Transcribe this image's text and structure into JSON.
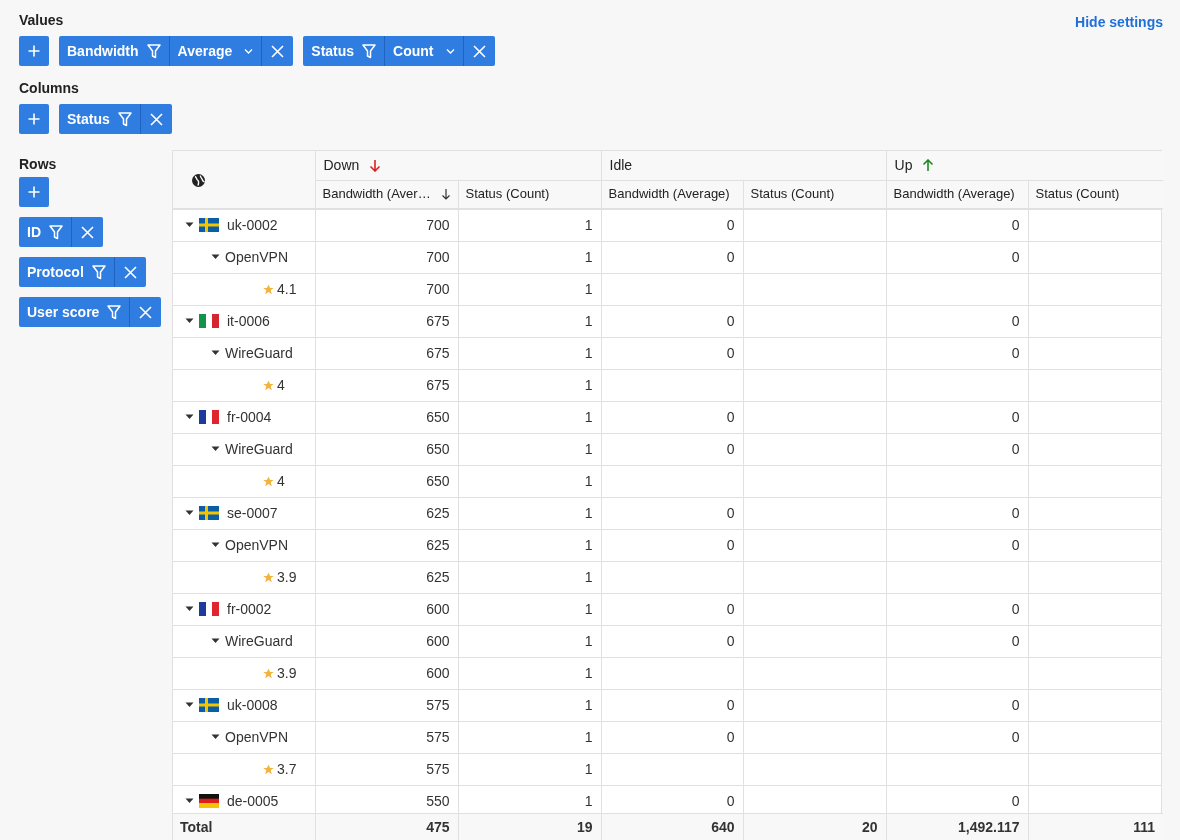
{
  "settings_link": "Hide settings",
  "values": {
    "label": "Values",
    "chips": [
      {
        "field": "Bandwidth",
        "aggregation": "Average"
      },
      {
        "field": "Status",
        "aggregation": "Count"
      }
    ]
  },
  "columns": {
    "label": "Columns",
    "chips": [
      {
        "field": "Status"
      }
    ]
  },
  "rows": {
    "label": "Rows",
    "chips": [
      {
        "field": "ID"
      },
      {
        "field": "Protocol"
      },
      {
        "field": "User score"
      }
    ]
  },
  "table": {
    "column_groups": [
      {
        "label": "Down",
        "kind": "down"
      },
      {
        "label": "Idle",
        "kind": "plain"
      },
      {
        "label": "Up",
        "kind": "up"
      }
    ],
    "columns": [
      {
        "label": "Bandwidth (Aver…",
        "sorted": true
      },
      {
        "label": "Status (Count)",
        "sorted": false
      },
      {
        "label": "Bandwidth (Average)",
        "sorted": false
      },
      {
        "label": "Status (Count)",
        "sorted": false
      },
      {
        "label": "Bandwidth (Average)",
        "sorted": false
      },
      {
        "label": "Status (Count)",
        "sorted": false
      }
    ],
    "rows": [
      {
        "label": "uk-0002",
        "kind": "se",
        "expanded": true,
        "cells": {
          "down_bandwidth": "700",
          "down_count": "1",
          "idle_bandwidth": "0",
          "up_bandwidth": "0"
        },
        "children": [
          {
            "label": "OpenVPN",
            "kind": "protocol",
            "expanded": true,
            "cells": {
              "down_bandwidth": "700",
              "down_count": "1",
              "idle_bandwidth": "0",
              "up_bandwidth": "0"
            },
            "children": [
              {
                "label": "4.1",
                "kind": "score",
                "cells": {
                  "down_bandwidth": "700",
                  "down_count": "1"
                }
              }
            ]
          }
        ]
      },
      {
        "label": "it-0006",
        "kind": "it",
        "expanded": true,
        "cells": {
          "down_bandwidth": "675",
          "down_count": "1",
          "idle_bandwidth": "0",
          "up_bandwidth": "0"
        },
        "children": [
          {
            "label": "WireGuard",
            "kind": "protocol",
            "expanded": true,
            "cells": {
              "down_bandwidth": "675",
              "down_count": "1",
              "idle_bandwidth": "0",
              "up_bandwidth": "0"
            },
            "children": [
              {
                "label": "4",
                "kind": "score",
                "cells": {
                  "down_bandwidth": "675",
                  "down_count": "1"
                }
              }
            ]
          }
        ]
      },
      {
        "label": "fr-0004",
        "kind": "fr",
        "expanded": true,
        "cells": {
          "down_bandwidth": "650",
          "down_count": "1",
          "idle_bandwidth": "0",
          "up_bandwidth": "0"
        },
        "children": [
          {
            "label": "WireGuard",
            "kind": "protocol",
            "expanded": true,
            "cells": {
              "down_bandwidth": "650",
              "down_count": "1",
              "idle_bandwidth": "0",
              "up_bandwidth": "0"
            },
            "children": [
              {
                "label": "4",
                "kind": "score",
                "cells": {
                  "down_bandwidth": "650",
                  "down_count": "1"
                }
              }
            ]
          }
        ]
      },
      {
        "label": "se-0007",
        "kind": "se",
        "expanded": true,
        "cells": {
          "down_bandwidth": "625",
          "down_count": "1",
          "idle_bandwidth": "0",
          "up_bandwidth": "0"
        },
        "children": [
          {
            "label": "OpenVPN",
            "kind": "protocol",
            "expanded": true,
            "cells": {
              "down_bandwidth": "625",
              "down_count": "1",
              "idle_bandwidth": "0",
              "up_bandwidth": "0"
            },
            "children": [
              {
                "label": "3.9",
                "kind": "score",
                "cells": {
                  "down_bandwidth": "625",
                  "down_count": "1"
                }
              }
            ]
          }
        ]
      },
      {
        "label": "fr-0002",
        "kind": "fr",
        "expanded": true,
        "cells": {
          "down_bandwidth": "600",
          "down_count": "1",
          "idle_bandwidth": "0",
          "up_bandwidth": "0"
        },
        "children": [
          {
            "label": "WireGuard",
            "kind": "protocol",
            "expanded": true,
            "cells": {
              "down_bandwidth": "600",
              "down_count": "1",
              "idle_bandwidth": "0",
              "up_bandwidth": "0"
            },
            "children": [
              {
                "label": "3.9",
                "kind": "score",
                "cells": {
                  "down_bandwidth": "600",
                  "down_count": "1"
                }
              }
            ]
          }
        ]
      },
      {
        "label": "uk-0008",
        "kind": "se",
        "expanded": true,
        "cells": {
          "down_bandwidth": "575",
          "down_count": "1",
          "idle_bandwidth": "0",
          "up_bandwidth": "0"
        },
        "children": [
          {
            "label": "OpenVPN",
            "kind": "protocol",
            "expanded": true,
            "cells": {
              "down_bandwidth": "575",
              "down_count": "1",
              "idle_bandwidth": "0",
              "up_bandwidth": "0"
            },
            "children": [
              {
                "label": "3.7",
                "kind": "score",
                "cells": {
                  "down_bandwidth": "575",
                  "down_count": "1"
                }
              }
            ]
          }
        ]
      },
      {
        "label": "de-0005",
        "kind": "de",
        "expanded": true,
        "cells": {
          "down_bandwidth": "550",
          "down_count": "1",
          "idle_bandwidth": "0",
          "up_bandwidth": "0"
        }
      }
    ],
    "total": {
      "label": "Total",
      "cells": {
        "down_bandwidth": "475",
        "down_count": "19",
        "idle_bandwidth": "640",
        "idle_count": "20",
        "up_bandwidth": "1,492.117",
        "up_count": "111"
      }
    }
  }
}
